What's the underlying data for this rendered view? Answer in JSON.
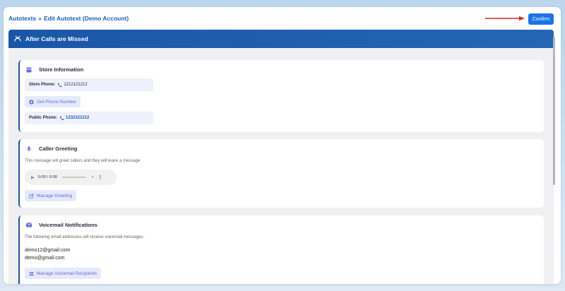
{
  "breadcrumb": {
    "parent": "Autotexts",
    "separator": "»",
    "current": "Edit Autotext (Demo Account)"
  },
  "confirm_label": "Confirm",
  "section": {
    "title": "After Calls are Missed",
    "icon": "missed-call-icon"
  },
  "store_information": {
    "title": "Store Information",
    "store_phone_label": "Store Phone:",
    "store_phone_value": "1212121212",
    "get_phone_number_label": "Get Phone Number",
    "public_phone_label": "Public Phone:",
    "public_phone_value": "1232321212"
  },
  "caller_greeting": {
    "title": "Caller Greeting",
    "description": "This message will greet callers and they will leave a message",
    "audio_time": "0:00 / 0:00",
    "manage_label": "Manage Greeting"
  },
  "voicemail": {
    "title": "Voicemail Notifications",
    "description": "The following email addresses will receive voicemail messages:",
    "emails": [
      "demo12@gmail.com",
      "demo@gmail.com"
    ],
    "manage_label": "Manage Voicemail Recipients"
  },
  "colors": {
    "header_blue": "#1a56a8",
    "accent": "#1a73e8",
    "link": "#1a5fb4",
    "soft_button_text": "#5b6fd6",
    "arrow_red": "#d32626"
  }
}
